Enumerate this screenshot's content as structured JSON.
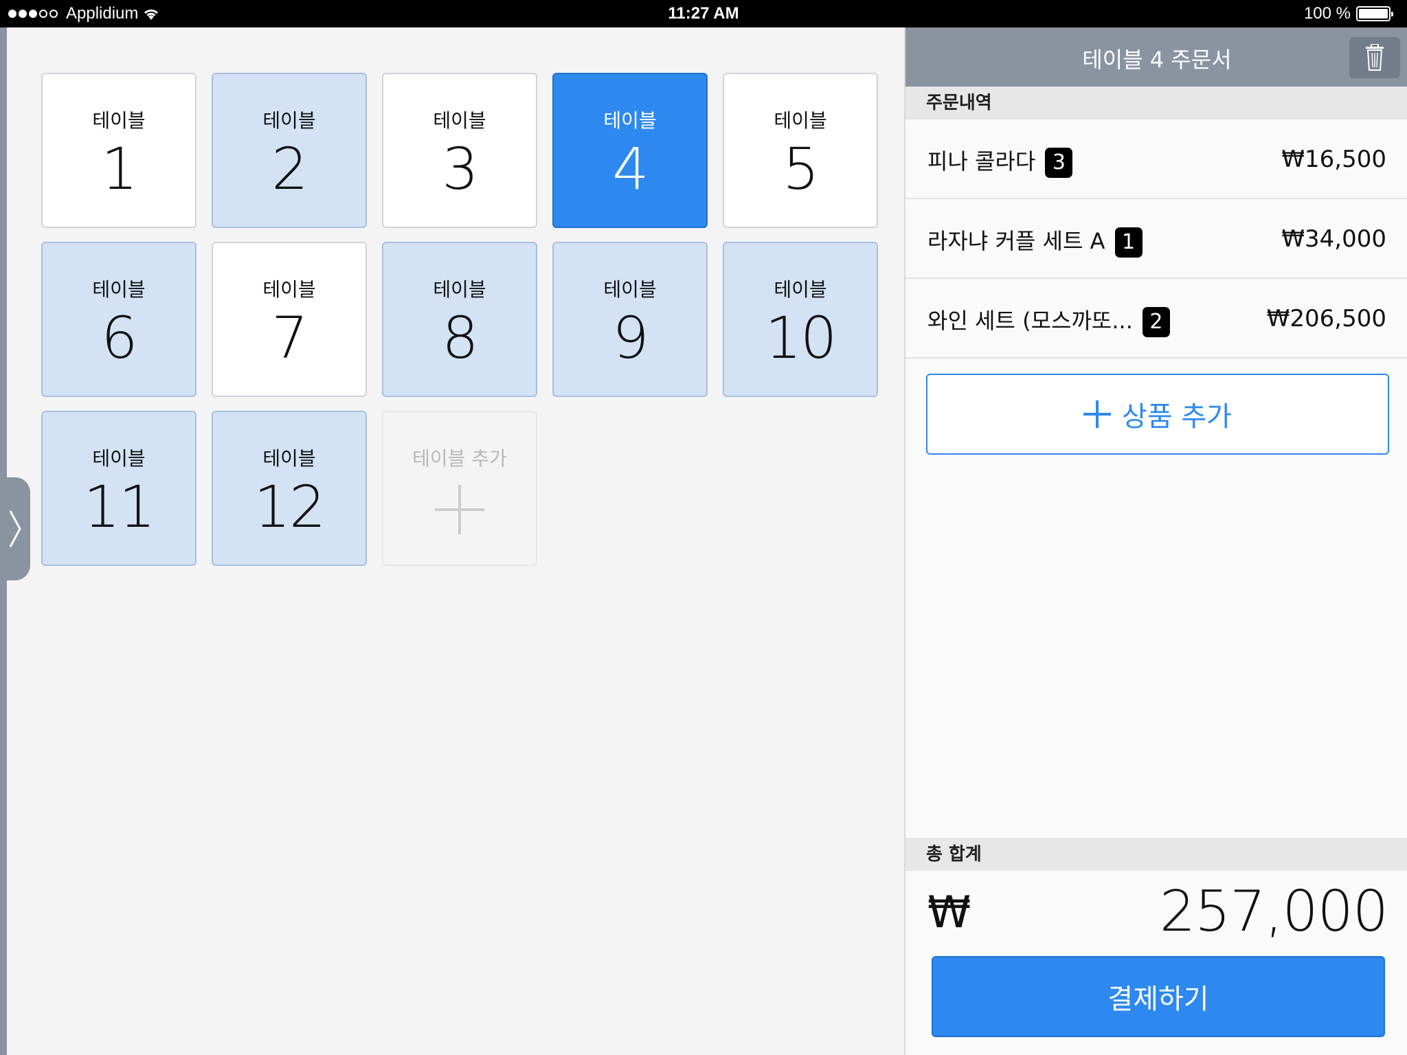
{
  "status_bar": {
    "carrier": "Applidium",
    "time": "11:27 AM",
    "battery": "100 %"
  },
  "tables": [
    {
      "label": "테이블",
      "number": "1",
      "state": "empty"
    },
    {
      "label": "테이블",
      "number": "2",
      "state": "occupied"
    },
    {
      "label": "테이블",
      "number": "3",
      "state": "empty"
    },
    {
      "label": "테이블",
      "number": "4",
      "state": "selected"
    },
    {
      "label": "테이블",
      "number": "5",
      "state": "empty"
    },
    {
      "label": "테이블",
      "number": "6",
      "state": "occupied"
    },
    {
      "label": "테이블",
      "number": "7",
      "state": "empty"
    },
    {
      "label": "테이블",
      "number": "8",
      "state": "occupied"
    },
    {
      "label": "테이블",
      "number": "9",
      "state": "occupied"
    },
    {
      "label": "테이블",
      "number": "10",
      "state": "occupied"
    },
    {
      "label": "테이블",
      "number": "11",
      "state": "occupied"
    },
    {
      "label": "테이블",
      "number": "12",
      "state": "occupied"
    }
  ],
  "add_table": {
    "label": "테이블 추가"
  },
  "panel": {
    "title": "테이블 4 주문서",
    "orders_header": "주문내역",
    "orders": [
      {
        "name": "피나 콜라다",
        "qty": "3",
        "price": "₩16,500"
      },
      {
        "name": "라자냐 커플 세트 A",
        "qty": "1",
        "price": "₩34,000"
      },
      {
        "name": "와인 세트 (모스까또...",
        "qty": "2",
        "price": "₩206,500"
      }
    ],
    "add_product_label": "상품 추가",
    "total_header": "총 합계",
    "currency_symbol": "₩",
    "total": "257,000",
    "pay_label": "결제하기"
  },
  "colors": {
    "accent": "#2d89f0",
    "occupied": "#d3e2f5",
    "header": "#8a93a0"
  }
}
